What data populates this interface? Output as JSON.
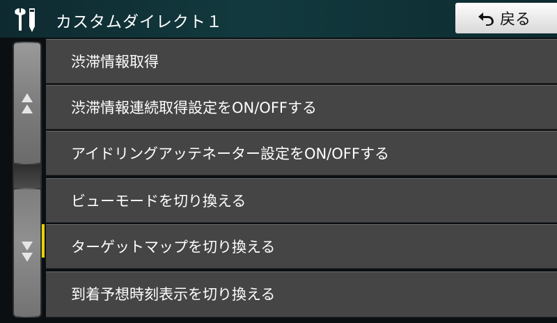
{
  "header": {
    "title": "カスタムダイレクト１",
    "icon": "tools-icon",
    "back_label": "戻る",
    "back_icon": "return-arrow-icon"
  },
  "scrollbar": {
    "up_icon": "double-up-arrow-icon",
    "down_icon": "double-down-arrow-icon",
    "marker_color": "#e8d200"
  },
  "list": {
    "items": [
      {
        "label": "渋滞情報取得"
      },
      {
        "label": "渋滞情報連続取得設定をON/OFFする"
      },
      {
        "label": "アイドリングアッテネーター設定をON/OFFする"
      },
      {
        "label": "ビューモードを切り換える"
      },
      {
        "label": "ターゲットマップを切り換える"
      },
      {
        "label": "到着予想時刻表示を切り換える"
      }
    ]
  }
}
